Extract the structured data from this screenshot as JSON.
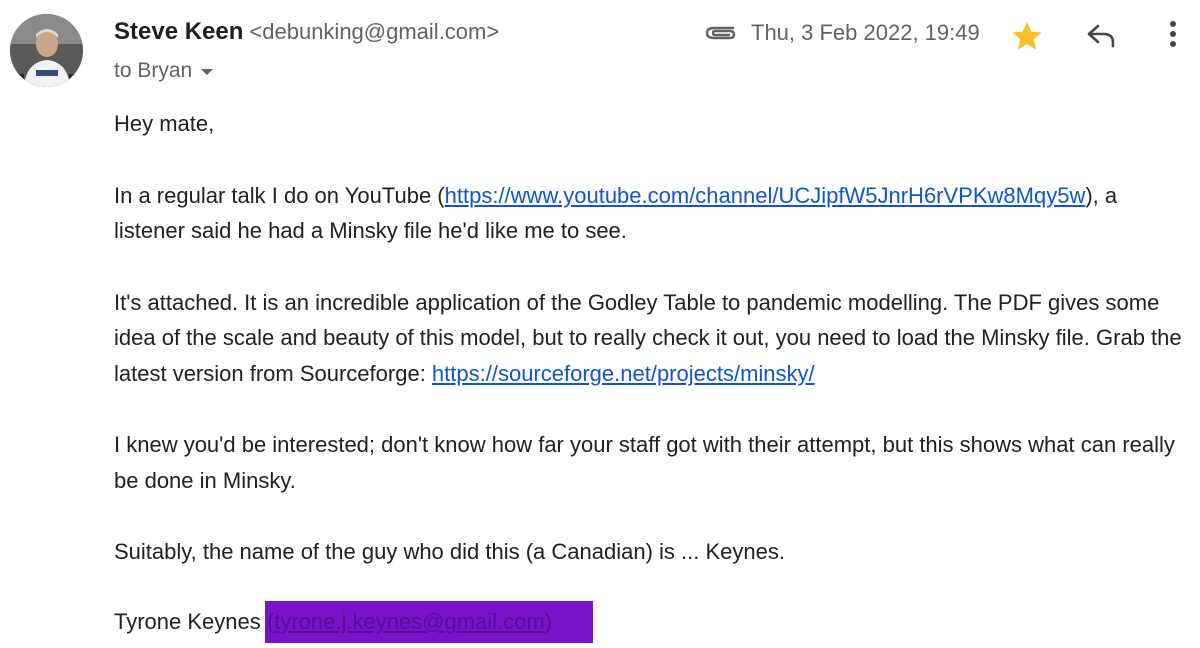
{
  "sender": {
    "name": "Steve Keen",
    "email": "<debunking@gmail.com>"
  },
  "recipient": {
    "label": "to Bryan"
  },
  "meta": {
    "date": "Thu, 3 Feb 2022, 19:49",
    "starred": true,
    "star_color": "#f6c026"
  },
  "icons": {
    "attachment": "paperclip-icon",
    "star": "star-icon",
    "reply": "reply-icon",
    "more": "more-vert-icon",
    "recipient_menu": "caret-down-icon"
  },
  "body": {
    "greeting": "Hey mate,",
    "p1_before": "In a regular talk I do on YouTube (",
    "p1_link": "https://www.youtube.com/channel/UCJipfW5JnrH6rVPKw8Mqy5w",
    "p1_after": "), a listener said he had a Minsky file he'd like me to see.",
    "p2_before": "It's attached. It is an incredible application of the Godley Table to pandemic modelling. The PDF gives some idea of the scale and beauty of this model, but to really check it out, you need to load the Minsky file. Grab the latest version from Sourceforge: ",
    "p2_link": "https://sourceforge.net/projects/minsky/",
    "p3": "I knew you'd be interested; don't know how far your staff got with their attempt, but this shows what can really be done in Minsky.",
    "p4": "Suitably, the name of the guy who did this (a Canadian) is ... Keynes."
  },
  "signature": {
    "name": "Tyrone Keynes",
    "redacted_open": "(",
    "redacted_email": "tyrone.j.keynes@gmail.com",
    "redacted_close": ")",
    "redaction_color": "#7a12c9"
  },
  "colors": {
    "link": "#1155cc",
    "muted": "#5f6368",
    "text": "#202124"
  }
}
